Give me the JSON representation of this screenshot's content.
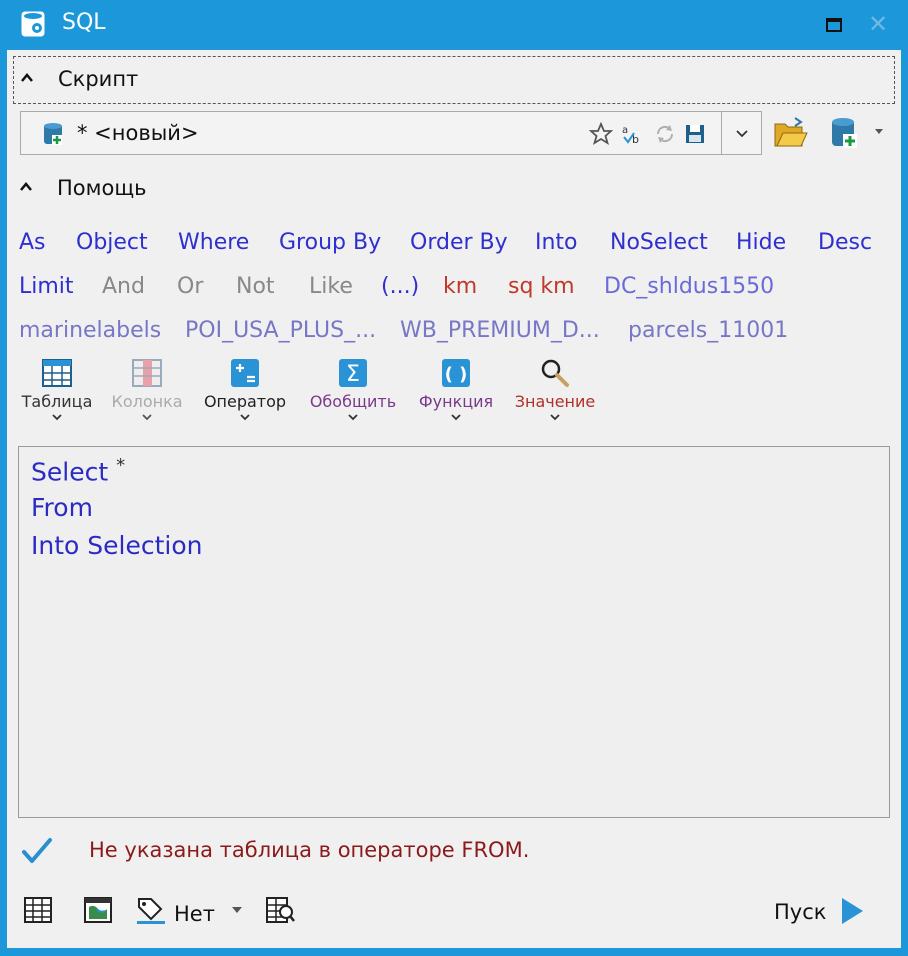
{
  "window": {
    "title": "SQL"
  },
  "sections": {
    "script": "Скрипт",
    "help": "Помощь"
  },
  "script_combo": {
    "value": "* <новый>"
  },
  "keywords_row1": [
    "As",
    "Object",
    "Where",
    "Group By",
    "Order By",
    "Into",
    "NoSelect",
    "Hide",
    "Desc"
  ],
  "keywords_row2": [
    "Limit",
    "And",
    "Or",
    "Not",
    "Like",
    "(...)",
    "km",
    "sq km",
    "DC_shldus1550"
  ],
  "tables_row": [
    "marinelabels",
    "POI_USA_PLUS_...",
    "WB_PREMIUM_D...",
    "parcels_11001"
  ],
  "tools": [
    "Таблица",
    "Колонка",
    "Оператор",
    "Обобщить",
    "Функция",
    "Значение"
  ],
  "editor": {
    "line1": "Select",
    "line1_suffix": "*",
    "line2": "From",
    "line3": "Into Selection"
  },
  "status": {
    "message": "Не указана таблица в операторе FROM."
  },
  "bottom": {
    "none_label": "Нет",
    "run_label": "Пуск"
  },
  "colors": {
    "titlebar": "#1c97d9",
    "keyword_blue": "#2f2fd0",
    "error_red": "#8b1a1a",
    "run_blue": "#2a93d5"
  }
}
